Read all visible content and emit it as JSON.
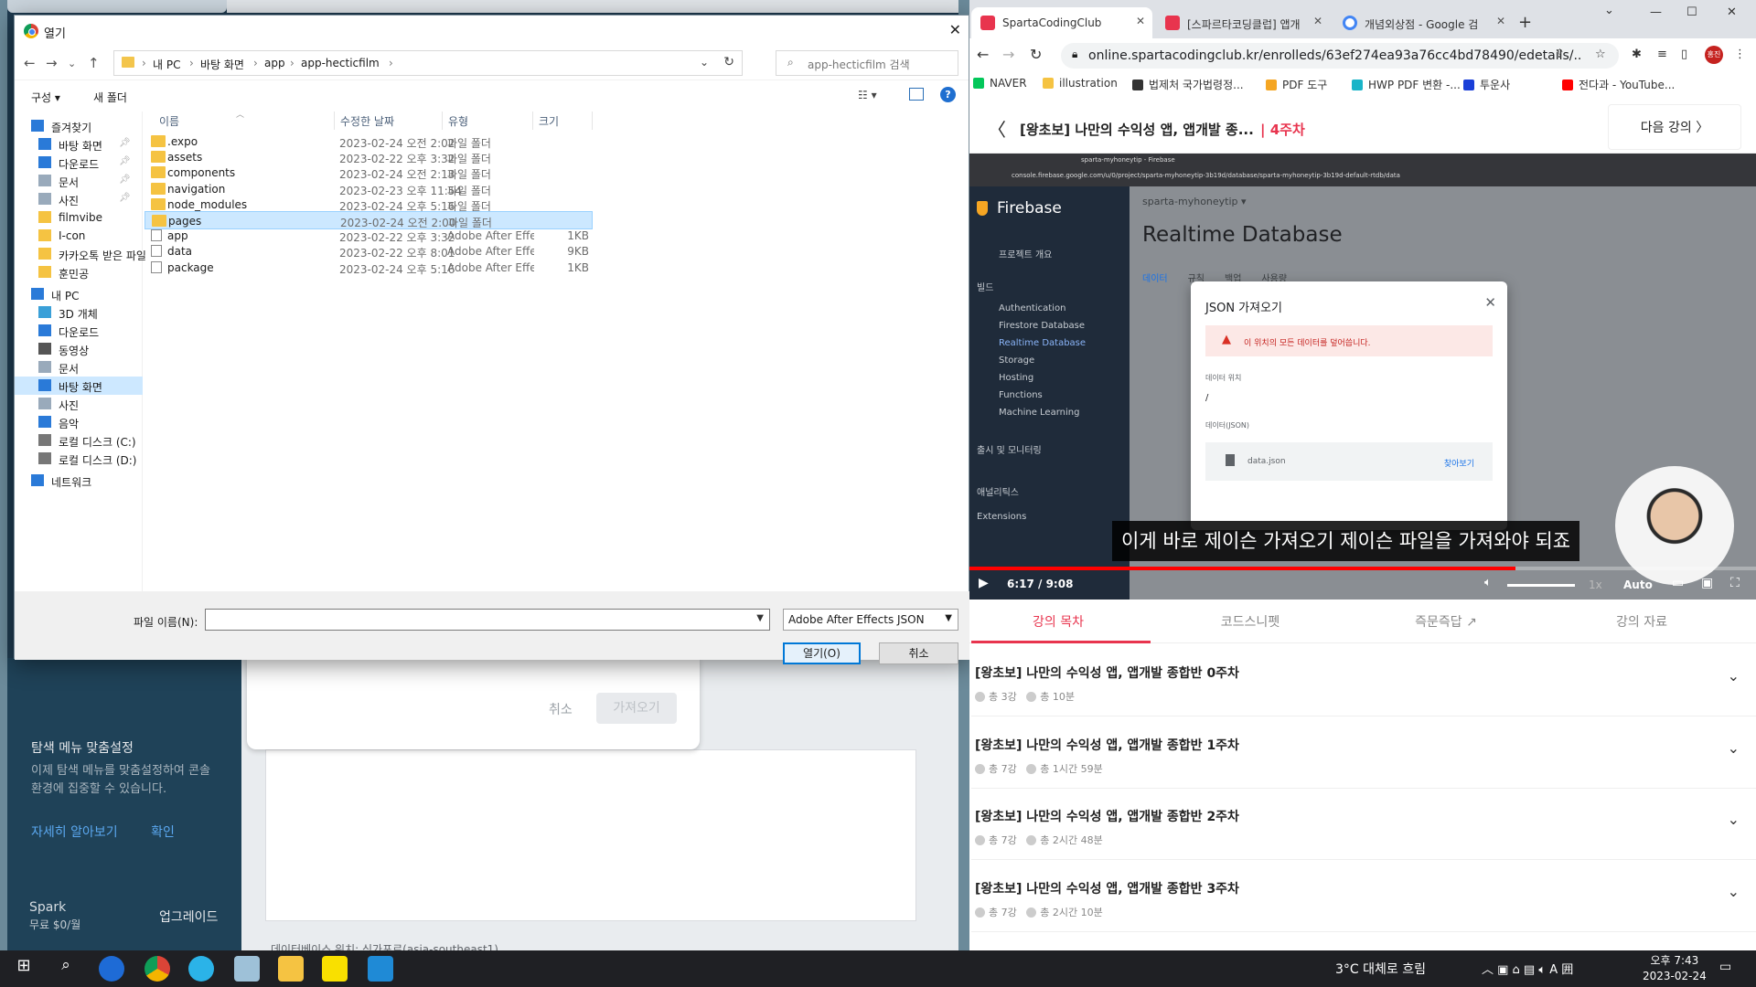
{
  "dialog": {
    "title": "열기",
    "breadcrumb": [
      "내 PC",
      "바탕 화면",
      "app",
      "app-hecticfilm"
    ],
    "search_placeholder": "app-hecticfilm 검색",
    "organize": "구성 ▾",
    "new_folder": "새 폴더",
    "help": "?",
    "tree": [
      {
        "label": "즐겨찾기",
        "icon": "star-icon",
        "color": "#2a7ad8"
      },
      {
        "label": "바탕 화면",
        "icon": "desktop-icon",
        "color": "#2a7ad8",
        "pin": true
      },
      {
        "label": "다운로드",
        "icon": "download-icon",
        "color": "#2a7ad8",
        "pin": true
      },
      {
        "label": "문서",
        "icon": "document-icon",
        "color": "#9ab",
        "pin": true
      },
      {
        "label": "사진",
        "icon": "pictures-icon",
        "color": "#9ab",
        "pin": true
      },
      {
        "label": "filmvibe",
        "icon": "folder-icon",
        "color": "#f5c342"
      },
      {
        "label": "I-con",
        "icon": "folder-icon",
        "color": "#f5c342"
      },
      {
        "label": "카카오톡 받은 파일",
        "icon": "folder-icon",
        "color": "#f5c342"
      },
      {
        "label": "훈민공",
        "icon": "folder-icon",
        "color": "#f5c342"
      },
      {
        "label": "내 PC",
        "icon": "pc-icon",
        "color": "#2a7ad8"
      },
      {
        "label": "3D 개체",
        "icon": "3d-icon",
        "color": "#3aa0d8"
      },
      {
        "label": "다운로드",
        "icon": "download-icon",
        "color": "#2a7ad8"
      },
      {
        "label": "동영상",
        "icon": "video-icon",
        "color": "#555"
      },
      {
        "label": "문서",
        "icon": "document-icon",
        "color": "#9ab"
      },
      {
        "label": "바탕 화면",
        "icon": "desktop-icon",
        "color": "#2a7ad8"
      },
      {
        "label": "사진",
        "icon": "pictures-icon",
        "color": "#9ab"
      },
      {
        "label": "음악",
        "icon": "music-icon",
        "color": "#2a7ad8"
      },
      {
        "label": "로컬 디스크 (C:)",
        "icon": "disk-icon",
        "color": "#777"
      },
      {
        "label": "로컬 디스크 (D:)",
        "icon": "disk-icon",
        "color": "#777"
      },
      {
        "label": "네트워크",
        "icon": "network-icon",
        "color": "#2a7ad8"
      }
    ],
    "columns": [
      "이름",
      "수정한 날짜",
      "유형",
      "크기"
    ],
    "files": [
      {
        "name": ".expo",
        "date": "2023-02-24 오전 2:02",
        "type": "파일 폴더",
        "size": "",
        "kind": "folder"
      },
      {
        "name": "assets",
        "date": "2023-02-22 오후 3:32",
        "type": "파일 폴더",
        "size": "",
        "kind": "folder"
      },
      {
        "name": "components",
        "date": "2023-02-24 오전 2:13",
        "type": "파일 폴더",
        "size": "",
        "kind": "folder"
      },
      {
        "name": "navigation",
        "date": "2023-02-23 오후 11:54",
        "type": "파일 폴더",
        "size": "",
        "kind": "folder"
      },
      {
        "name": "node_modules",
        "date": "2023-02-24 오후 5:16",
        "type": "파일 폴더",
        "size": "",
        "kind": "folder"
      },
      {
        "name": "pages",
        "date": "2023-02-24 오전 2:00",
        "type": "파일 폴더",
        "size": "",
        "kind": "folder"
      },
      {
        "name": "app",
        "date": "2023-02-22 오후 3:32",
        "type": "Adobe After Effec...",
        "size": "1KB",
        "kind": "file"
      },
      {
        "name": "data",
        "date": "2023-02-22 오후 8:01",
        "type": "Adobe After Effec...",
        "size": "9KB",
        "kind": "file"
      },
      {
        "name": "package",
        "date": "2023-02-24 오후 5:16",
        "type": "Adobe After Effec...",
        "size": "1KB",
        "kind": "file"
      }
    ],
    "filename_label": "파일 이름(N):",
    "filename_value": "",
    "filetype": "Adobe After Effects JSON",
    "open_btn": "열기(O)",
    "cancel_btn": "취소"
  },
  "background": {
    "modal_cancel": "취소",
    "modal_import": "가져오기",
    "tip_title": "탐색 메뉴 맞춤설정",
    "tip_desc": "이제 탐색 메뉴를 맞춤설정하여 콘솔 환경에 집중할 수 있습니다.",
    "tip_learn": "자세히 알아보기",
    "tip_ok": "확인",
    "plan": "Spark",
    "plan_price": "무료 $0/월",
    "upgrade": "업그레이드",
    "db_location": "데이터베이스 위치: 싱가포르(asia-southeast1)"
  },
  "chrome": {
    "tabs": [
      {
        "title": "SpartaCodingClub",
        "color": "#e8344e"
      },
      {
        "title": "[스파르타코딩클럽] 앱개",
        "color": "#e8344e"
      },
      {
        "title": "개념외상점 - Google 검",
        "color": "#4285f4"
      }
    ],
    "url": "online.spartacodingclub.kr/enrolleds/63ef274ea93a76cc4bd78490/edetails/...",
    "profile": "홍진",
    "bookmarks": [
      {
        "label": "NAVER",
        "color": "#03c75a"
      },
      {
        "label": "illustration",
        "color": "#f5c342"
      },
      {
        "label": "법제처 국가법령정...",
        "color": "#333"
      },
      {
        "label": "PDF 도구",
        "color": "#f5a623"
      },
      {
        "label": "HWP PDF 변환 -...",
        "color": "#19b4c8"
      },
      {
        "label": "투운사",
        "color": "#1a3fd8"
      },
      {
        "label": "전다과 - YouTube...",
        "color": "#f00"
      }
    ],
    "lecture_title": "[왕초보] 나만의 수익성 앱, 앱개발 종...",
    "week_tag": "| 4주차",
    "next": "다음 강의 〉"
  },
  "video": {
    "browser_tabs": "sparta-myhoneytip - Firebase",
    "console_url": "console.firebase.google.com/u/0/project/sparta-myhoneytip-3b19d/database/sparta-myhoneytip-3b19d-default-rtdb/data",
    "project": "sparta-myhoneytip ▾",
    "brand": "Firebase",
    "page_title": "Realtime Database",
    "tabs": [
      "데이터",
      "규칙",
      "백업",
      "사용량"
    ],
    "sidebar": [
      {
        "label": "프로젝트 개요",
        "hl": false
      },
      {
        "label": "빌드",
        "hl": false
      },
      {
        "label": "Authentication",
        "hl": false
      },
      {
        "label": "Firestore Database",
        "hl": false
      },
      {
        "label": "Realtime Database",
        "hl": true
      },
      {
        "label": "Storage",
        "hl": false
      },
      {
        "label": "Hosting",
        "hl": false
      },
      {
        "label": "Functions",
        "hl": false
      },
      {
        "label": "Machine Learning",
        "hl": false
      },
      {
        "label": "출시 및 모니터링",
        "hl": false
      },
      {
        "label": "애널리틱스",
        "hl": false
      },
      {
        "label": "Extensions",
        "hl": false
      }
    ],
    "modal_title": "JSON 가져오기",
    "modal_warn": "이 위치의 모든 데이터를 덮어씁니다.",
    "loc_label": "데이터 위치",
    "loc_value": "/",
    "data_label": "데이터(JSON)",
    "file": "data.json",
    "browse": "찾아보기",
    "subtitle": "이게 바로 제이슨 가져오기 제이슨 파일을 가져와야 되죠",
    "time": "6:17  /  9:08",
    "progress": 0.694,
    "speed": "1x",
    "quality": "Auto"
  },
  "lecture_tabs": [
    "강의 목차",
    "코드스니펫",
    "즉문즉답 ↗",
    "강의 자료"
  ],
  "weeks": [
    {
      "title": "[왕초보] 나만의 수익성 앱, 앱개발 종합반 0주차",
      "count": "총 3강",
      "dur": "총 10분"
    },
    {
      "title": "[왕초보] 나만의 수익성 앱, 앱개발 종합반 1주차",
      "count": "총 7강",
      "dur": "총 1시간 59분"
    },
    {
      "title": "[왕초보] 나만의 수익성 앱, 앱개발 종합반 2주차",
      "count": "총 7강",
      "dur": "총 2시간 48분"
    },
    {
      "title": "[왕초보] 나만의 수익성 앱, 앱개발 종합반 3주차",
      "count": "총 7강",
      "dur": "총 2시간 10분"
    }
  ],
  "taskbar": {
    "weather": "3°C  대체로 흐림",
    "time": "오후 7:43",
    "date": "2023-02-24"
  }
}
